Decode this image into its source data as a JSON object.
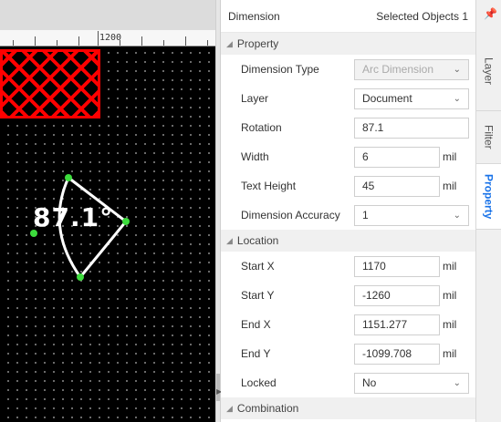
{
  "canvas": {
    "ruler_label": "1200",
    "dimension_value": "87.1°"
  },
  "panel": {
    "title": "Dimension",
    "selected": "Selected Objects 1",
    "sections": {
      "property": "Property",
      "location": "Location",
      "combination": "Combination"
    },
    "property": {
      "dimension_type": {
        "label": "Dimension Type",
        "value": "Arc Dimension"
      },
      "layer": {
        "label": "Layer",
        "value": "Document"
      },
      "rotation": {
        "label": "Rotation",
        "value": "87.1"
      },
      "width": {
        "label": "Width",
        "value": "6",
        "unit": "mil"
      },
      "text_height": {
        "label": "Text Height",
        "value": "45",
        "unit": "mil"
      },
      "accuracy": {
        "label": "Dimension Accuracy",
        "value": "1"
      }
    },
    "location": {
      "start_x": {
        "label": "Start X",
        "value": "1170",
        "unit": "mil"
      },
      "start_y": {
        "label": "Start Y",
        "value": "-1260",
        "unit": "mil"
      },
      "end_x": {
        "label": "End X",
        "value": "1151.277",
        "unit": "mil"
      },
      "end_y": {
        "label": "End Y",
        "value": "-1099.708",
        "unit": "mil"
      },
      "locked": {
        "label": "Locked",
        "value": "No"
      }
    }
  },
  "tabs": [
    "Layer",
    "Filter",
    "Property"
  ],
  "active_tab": "Property"
}
